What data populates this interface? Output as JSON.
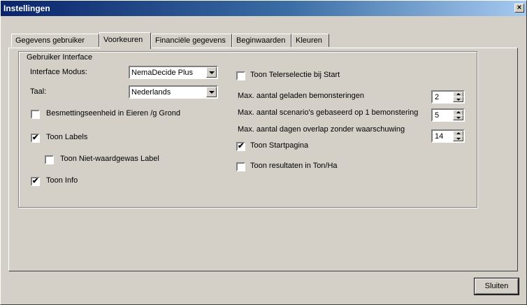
{
  "window": {
    "title": "Instellingen",
    "close_glyph": "×"
  },
  "tabs": [
    {
      "label": "Gegevens gebruiker",
      "active": false
    },
    {
      "label": "Voorkeuren",
      "active": true
    },
    {
      "label": "Financiële gegevens",
      "active": false
    },
    {
      "label": "Beginwaarden",
      "active": false
    },
    {
      "label": "Kleuren",
      "active": false
    }
  ],
  "group": {
    "title": "Gebruiker Interface",
    "interface_mode": {
      "label": "Interface Modus:",
      "value": "NemaDecide Plus"
    },
    "language": {
      "label": "Taal:",
      "value": "Nederlands"
    },
    "checkboxes": {
      "infection_unit": {
        "label": "Besmettingseenheid in Eieren /g Grond",
        "checked": false
      },
      "show_labels": {
        "label": "Toon Labels",
        "checked": true
      },
      "show_non_host_label": {
        "label": "Toon Niet-waardgewas Label",
        "checked": false
      },
      "show_info": {
        "label": "Toon Info",
        "checked": true
      },
      "show_grower_selection": {
        "label": "Toon Telerselectie bij Start",
        "checked": false
      },
      "show_start_page": {
        "label": "Toon Startpagina",
        "checked": true
      },
      "show_results_ton_ha": {
        "label": "Toon resultaten in Ton/Ha",
        "checked": false
      }
    },
    "spinners": {
      "max_samplings": {
        "label": "Max. aantal geladen bemonsteringen",
        "value": "2"
      },
      "max_scenarios": {
        "label": "Max. aantal scenario's gebaseerd op 1 bemonstering",
        "value": "5"
      },
      "max_overlap_days": {
        "label": "Max. aantal dagen overlap zonder waarschuwing",
        "value": "14"
      }
    }
  },
  "footer": {
    "close_label": "Sluiten"
  },
  "glyphs": {
    "check": "✔"
  }
}
